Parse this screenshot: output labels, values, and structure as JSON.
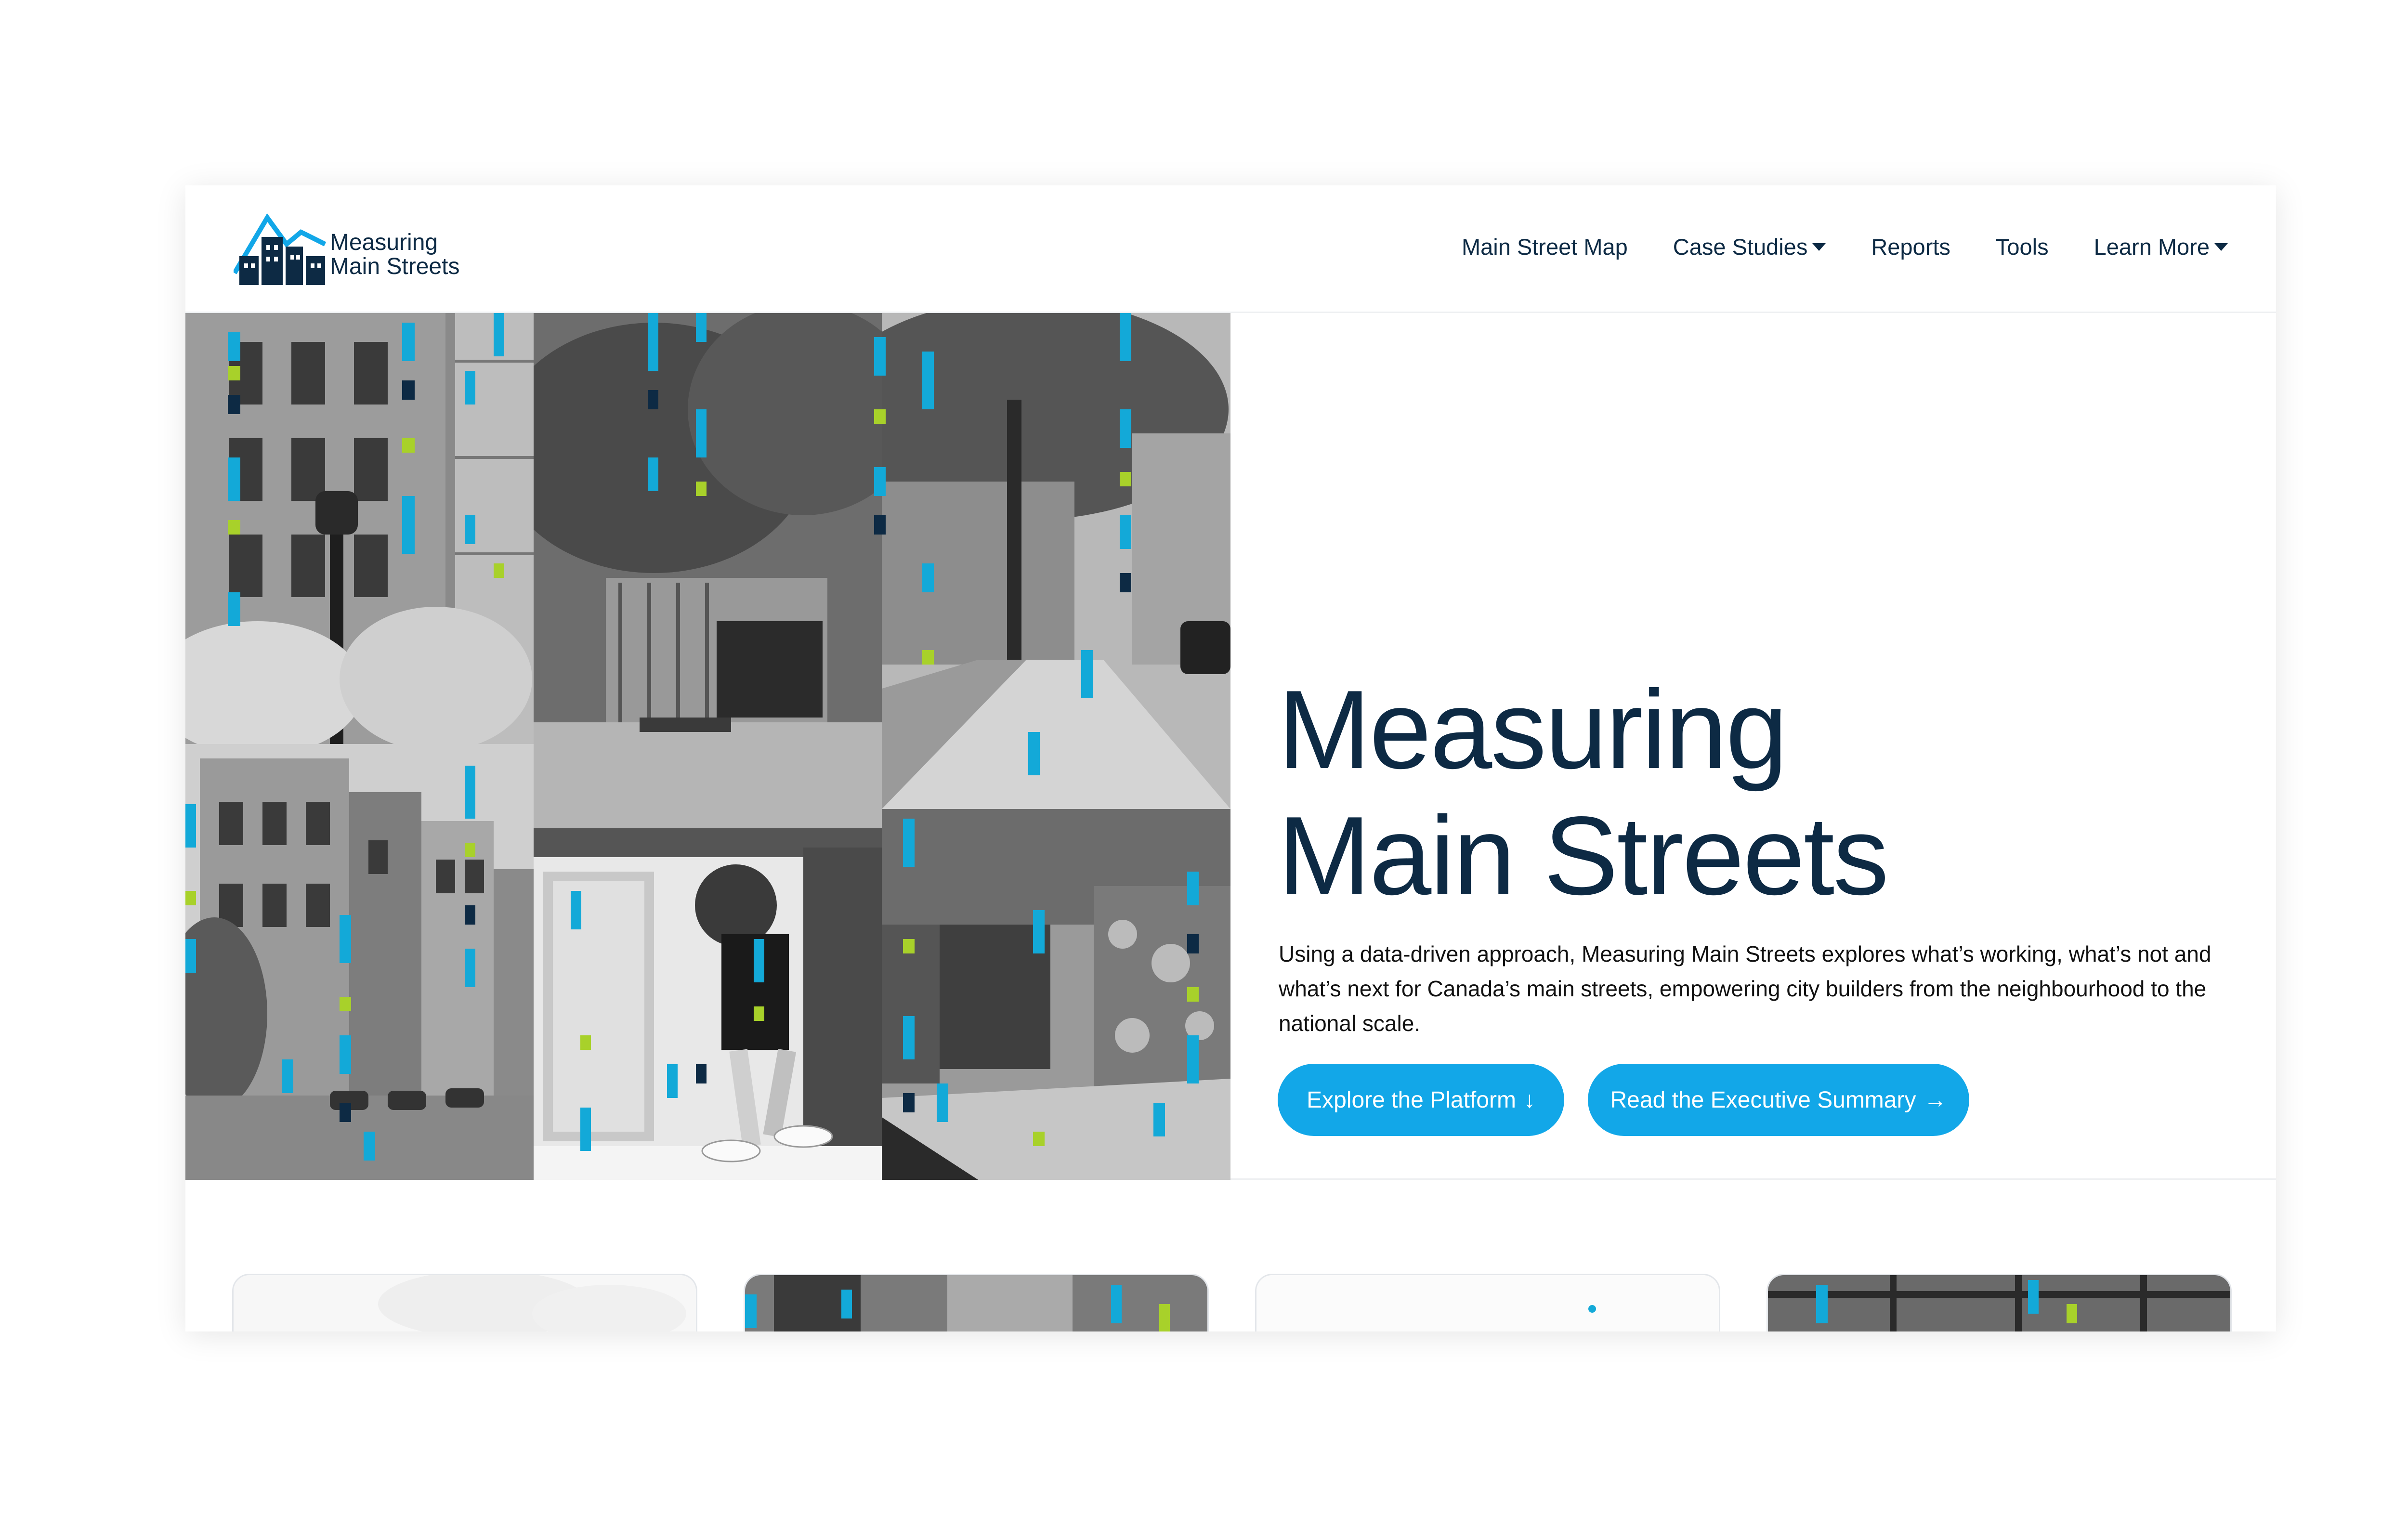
{
  "header": {
    "logo_line1": "Measuring",
    "logo_line2": "Main Streets",
    "nav": {
      "main_street_map": "Main Street Map",
      "case_studies": "Case Studies",
      "reports": "Reports",
      "tools": "Tools",
      "learn_more": "Learn More"
    }
  },
  "hero": {
    "title_line1": "Measuring",
    "title_line2": "Main Streets",
    "description": "Using a data-driven approach, Measuring Main Streets explores what’s working, what’s not and what’s next for Canada’s main streets, empowering city builders from the neighbourhood to the national scale.",
    "explore_label": "Explore the Platform",
    "explore_icon": "↓",
    "summary_label": "Read the Executive Summary",
    "summary_icon": "→"
  },
  "colors": {
    "brand_navy": "#0d2a44",
    "accent_blue": "#12a7e8",
    "pixel_cyan": "#13a9d8",
    "pixel_lime": "#a8d12a",
    "pixel_navy": "#0d2a44"
  },
  "icons": [
    "logo-buildings-icon",
    "caret-down-icon",
    "arrow-down-icon",
    "arrow-right-icon"
  ]
}
